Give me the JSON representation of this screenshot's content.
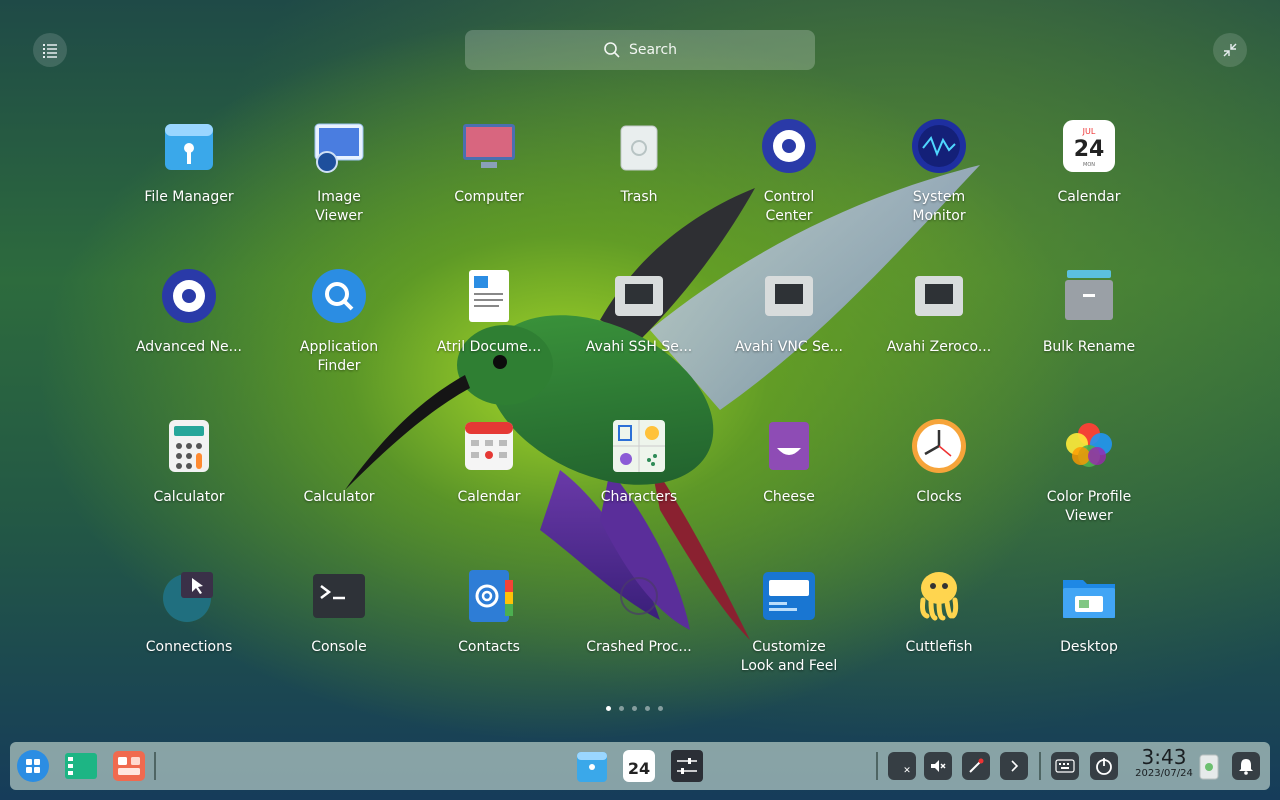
{
  "search": {
    "label": "Search"
  },
  "apps": [
    {
      "id": "file-manager",
      "label": "File Manager"
    },
    {
      "id": "image-viewer",
      "label": "Image\nViewer"
    },
    {
      "id": "computer",
      "label": "Computer"
    },
    {
      "id": "trash",
      "label": "Trash"
    },
    {
      "id": "control-center",
      "label": "Control\nCenter"
    },
    {
      "id": "system-monitor",
      "label": "System\nMonitor"
    },
    {
      "id": "calendar",
      "label": "Calendar"
    },
    {
      "id": "advanced-network",
      "label": "Advanced Ne..."
    },
    {
      "id": "application-finder",
      "label": "Application\nFinder"
    },
    {
      "id": "atril-document",
      "label": "Atril Docume..."
    },
    {
      "id": "avahi-ssh",
      "label": "Avahi SSH Se..."
    },
    {
      "id": "avahi-vnc",
      "label": "Avahi VNC Se..."
    },
    {
      "id": "avahi-zeroconf",
      "label": "Avahi Zeroco..."
    },
    {
      "id": "bulk-rename",
      "label": "Bulk Rename"
    },
    {
      "id": "calculator-1",
      "label": "Calculator"
    },
    {
      "id": "calculator-2",
      "label": "Calculator"
    },
    {
      "id": "calendar-2",
      "label": "Calendar"
    },
    {
      "id": "characters",
      "label": "Characters"
    },
    {
      "id": "cheese",
      "label": "Cheese"
    },
    {
      "id": "clocks",
      "label": "Clocks"
    },
    {
      "id": "color-profile-viewer",
      "label": "Color Profile\nViewer"
    },
    {
      "id": "connections",
      "label": "Connections"
    },
    {
      "id": "console",
      "label": "Console"
    },
    {
      "id": "contacts",
      "label": "Contacts"
    },
    {
      "id": "crashed-processes",
      "label": "Crashed Proc..."
    },
    {
      "id": "customize-look",
      "label": "Customize\nLook and Feel"
    },
    {
      "id": "cuttlefish",
      "label": "Cuttlefish"
    },
    {
      "id": "desktop",
      "label": "Desktop"
    }
  ],
  "calendar_icon": {
    "month": "JUL",
    "day": "24",
    "weekday": "MON"
  },
  "pager": {
    "pages": 5,
    "current": 1
  },
  "dock": {
    "calendar_day": "24",
    "clock_time": "3:43",
    "clock_date": "2023/07/24"
  },
  "colors": {
    "accent": "#2b8de3",
    "dock": "#cde1d7"
  }
}
